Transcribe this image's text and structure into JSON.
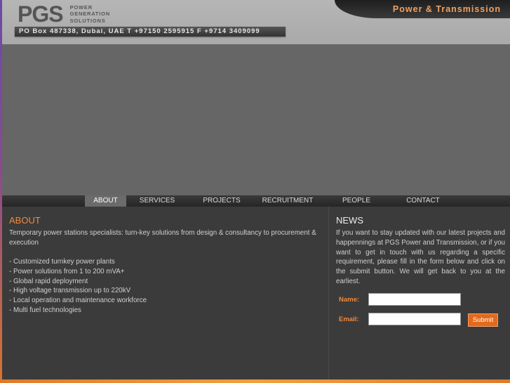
{
  "header": {
    "logo_text": "PGS",
    "logo_subtitle_1": "POWER",
    "logo_subtitle_2": "GENERATION",
    "logo_subtitle_3": "SOLUTIONS",
    "contact": "PO Box 487338, Dubai, UAE T +97150 2595915 F +9714 3409099",
    "tagline": "Power & Transmission"
  },
  "nav": {
    "items": [
      {
        "label": "ABOUT",
        "active": true
      },
      {
        "label": "SERVICES"
      },
      {
        "label": "PROJECTS"
      },
      {
        "label": "RECRUITMENT"
      },
      {
        "label": "PEOPLE"
      },
      {
        "label": "CONTACT"
      }
    ]
  },
  "about": {
    "heading": "ABOUT",
    "intro": "Temporary power stations specialists: turn-key solutions from design & consultancy to procurement & execution",
    "items": [
      "- Customized turnkey power plants",
      "- Power solutions from 1 to 200 mVA+",
      "- Global rapid deployment",
      "- High voltage transmission up to 220kV",
      "- Local operation and maintenance workforce",
      "- Multi fuel technologies"
    ]
  },
  "news": {
    "heading": "NEWS",
    "text": "If you want to stay updated with our latest projects and happennings at PGS Power and Transmission, or if you want to get in touch with us regarding a specific requirement, please fill in the form below and click on the submit button. We will get back to you at the earliest.",
    "name_label": "Name:",
    "email_label": "Email:",
    "name_value": "",
    "email_value": "",
    "submit_label": "Submit"
  }
}
